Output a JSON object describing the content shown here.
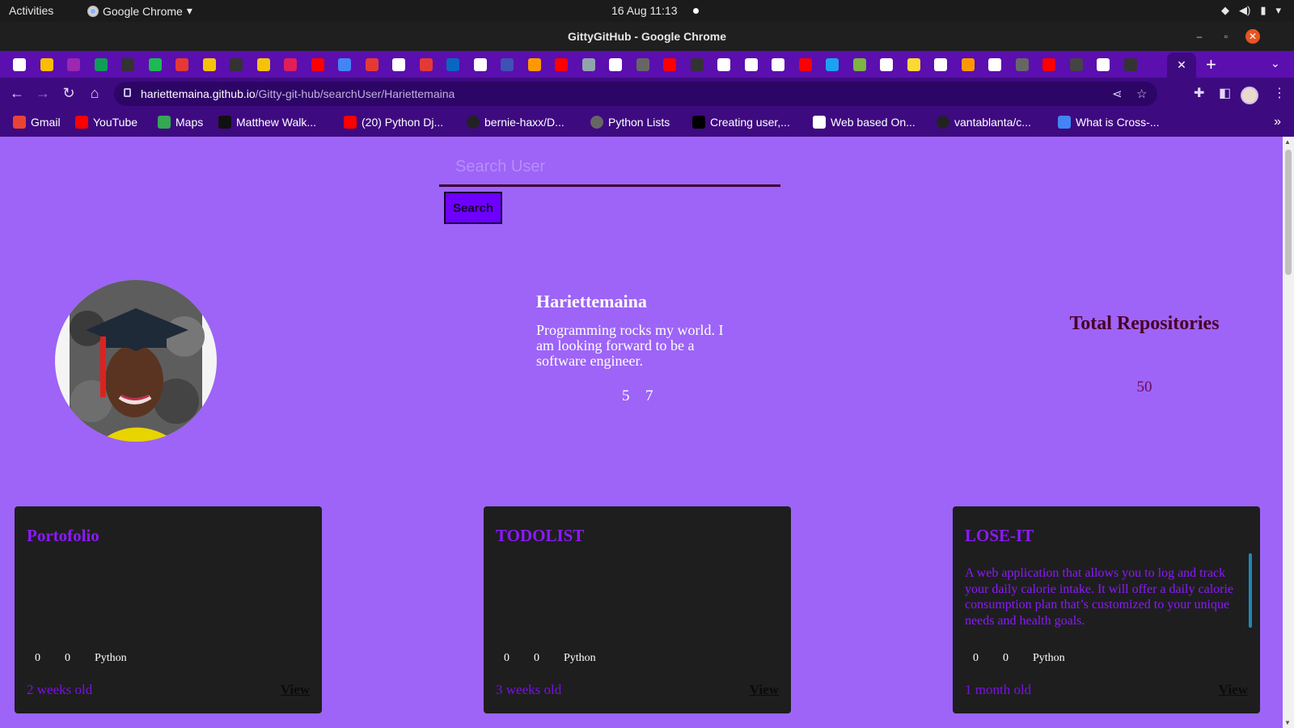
{
  "system_bar": {
    "activities": "Activities",
    "app_name": "Google Chrome",
    "clock": "16 Aug  11:13"
  },
  "window": {
    "title": "GittyGitHub - Google Chrome"
  },
  "browser": {
    "url_host": "hariettemaina.github.io",
    "url_path": "/Gitty-git-hub/searchUser/Hariettemaina",
    "bookmarks": [
      {
        "label": "Gmail",
        "color": "#ea4335"
      },
      {
        "label": "YouTube",
        "color": "#ff0000"
      },
      {
        "label": "Maps",
        "color": "#34a853"
      },
      {
        "label": "Matthew Walk...",
        "color": "#111111"
      },
      {
        "label": "(20) Python Dj...",
        "color": "#ff0000"
      },
      {
        "label": "bernie-haxx/D...",
        "color": "#222222"
      },
      {
        "label": "Python Lists",
        "color": "#666666"
      },
      {
        "label": "Creating user,...",
        "color": "#000000"
      },
      {
        "label": "Web based On...",
        "color": "#ffffff"
      },
      {
        "label": "vantablanta/c...",
        "color": "#222222"
      },
      {
        "label": "What is Cross-...",
        "color": "#4285f4"
      }
    ],
    "tab_favicon_colors": [
      "#ffffff",
      "#fbbc04",
      "#9c27b0",
      "#0f9d58",
      "#333333",
      "#1db954",
      "#e53935",
      "#f4c20d",
      "#333333",
      "#f4c20d",
      "#e01e5a",
      "#ff0000",
      "#4285f4",
      "#e53935",
      "#ffffff",
      "#e53935",
      "#0a66c2",
      "#ffffff",
      "#3f51b5",
      "#ff9800",
      "#ff0000",
      "#90a4ae",
      "#ffffff",
      "#666666",
      "#ff0000",
      "#333333",
      "#ffffff",
      "#ffffff",
      "#ffffff",
      "#ff0000",
      "#1da1f2",
      "#7cb342",
      "#ffffff",
      "#fdd835",
      "#ffffff",
      "#ff9800",
      "#ffffff",
      "#666666",
      "#ff0000",
      "#444444",
      "#ffffff",
      "#333333"
    ]
  },
  "page": {
    "search": {
      "placeholder": "Search User",
      "button_label": "Search"
    },
    "profile": {
      "username": "Hariettemaina",
      "bio": "Programming rocks my world. I am looking forward to be a software engineer.",
      "followers": "5",
      "following": "7"
    },
    "repos_summary": {
      "label": "Total Repositories",
      "value": "50"
    },
    "repos": [
      {
        "name": "Portofolio",
        "description": "",
        "stars": "0",
        "forks": "0",
        "language": "Python",
        "age": "2 weeks old",
        "view_label": "View"
      },
      {
        "name": "TODOLIST",
        "description": "",
        "stars": "0",
        "forks": "0",
        "language": "Python",
        "age": "3 weeks old",
        "view_label": "View"
      },
      {
        "name": "LOSE-IT",
        "description": "A web application that allows you to log and track your daily calorie intake. It will offer a daily calorie consumption plan that’s customized to your unique needs and health goals.",
        "stars": "0",
        "forks": "0",
        "language": "Python",
        "age": "1 month old",
        "view_label": "View"
      }
    ]
  },
  "colors": {
    "page_background": "#9d64f7",
    "browser_frame": "#3e0a80",
    "card_background": "#1e1e1e",
    "repo_name": "#8c19ff",
    "search_button": "#6d00ff"
  }
}
